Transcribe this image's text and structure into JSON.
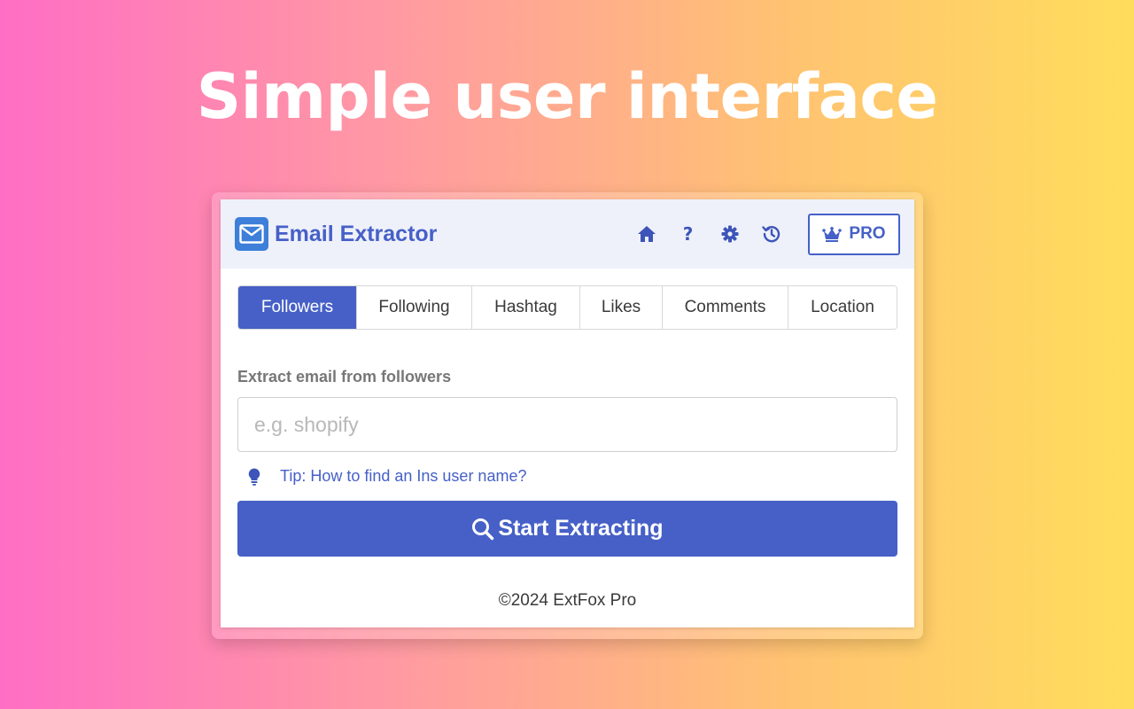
{
  "headline": "Simple user interface",
  "header": {
    "logo_icon": "envelope-icon",
    "title": "Email Extractor",
    "nav_icons": [
      "home-icon",
      "help-icon",
      "gear-icon",
      "history-icon"
    ],
    "help_glyph": "?",
    "pro_icon": "crown-icon",
    "pro_label": "PRO"
  },
  "tabs": [
    {
      "label": "Followers",
      "active": true
    },
    {
      "label": "Following",
      "active": false
    },
    {
      "label": "Hashtag",
      "active": false
    },
    {
      "label": "Likes",
      "active": false
    },
    {
      "label": "Comments",
      "active": false
    },
    {
      "label": "Location",
      "active": false
    }
  ],
  "form": {
    "label": "Extract email from followers",
    "input_value": "",
    "input_placeholder": "e.g. shopify",
    "tip_icon": "lightbulb-icon",
    "tip_text": "Tip: How to find an Ins user name?",
    "button_icon": "search-icon",
    "button_label": "Start Extracting"
  },
  "footer": {
    "text": "©2024 ExtFox Pro"
  },
  "colors": {
    "accent": "#4660c7",
    "header_bg": "#eef1fa",
    "logo_bg": "#3d7fd9"
  }
}
